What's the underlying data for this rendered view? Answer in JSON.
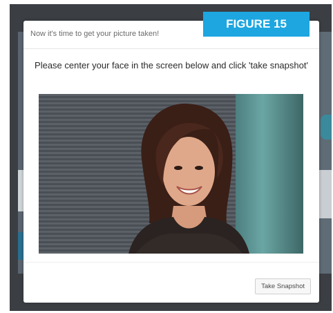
{
  "badge": {
    "label": "FIGURE 15"
  },
  "modal": {
    "title": "Now it's time to get your picture taken!",
    "instruction": "Please center your face in the screen below and click 'take snapshot'",
    "take_snapshot_label": "Take Snapshot"
  },
  "colors": {
    "badge": "#1da6e0",
    "overlay": "#3b3f44"
  }
}
